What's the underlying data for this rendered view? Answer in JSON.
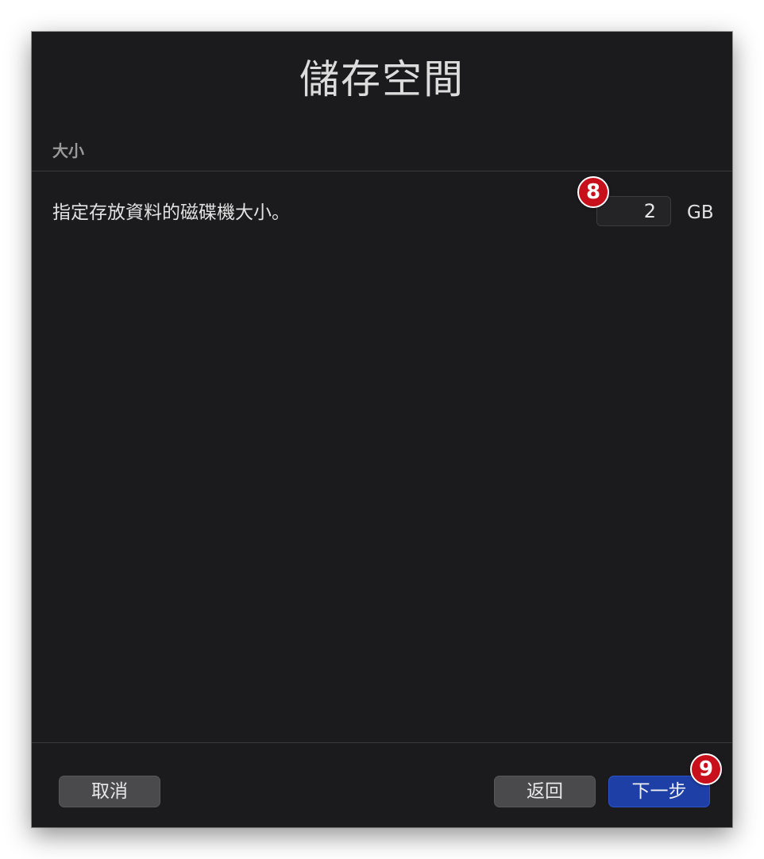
{
  "dialog": {
    "title": "儲存空間",
    "section_label": "大小",
    "description": "指定存放資料的磁碟機大小。",
    "size_value": "2",
    "size_unit": "GB"
  },
  "buttons": {
    "cancel": "取消",
    "back": "返回",
    "next": "下一步"
  },
  "annotations": {
    "badge_size": "8",
    "badge_next": "9"
  },
  "colors": {
    "window_bg": "#1b1b1d",
    "primary_button": "#1d3fa6",
    "secondary_button": "#4a4a4c",
    "badge": "#c8101c"
  }
}
